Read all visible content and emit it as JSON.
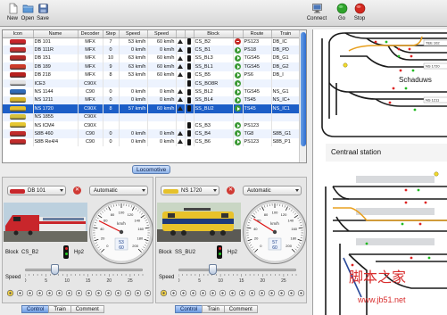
{
  "toolbar": {
    "new_label": "New",
    "open_label": "Open",
    "save_label": "Save",
    "connect_label": "Connect",
    "go_label": "Go",
    "stop_label": "Stop"
  },
  "table": {
    "headers": [
      "Icon",
      "Name",
      "Decoder",
      "Step",
      "Speed",
      "Speed",
      "",
      "",
      "Block",
      "",
      "Route",
      "Train"
    ],
    "rows": [
      {
        "name": "DB 101",
        "decoder": "MFX",
        "step": "7",
        "speed1": "53 km/h",
        "speed2": "60 km/h",
        "block": "CS_B2",
        "signal": "stop",
        "route": "PS123",
        "train": "DB_IC",
        "color": "#c8262b"
      },
      {
        "name": "DB 111R",
        "decoder": "MFX",
        "step": "0",
        "speed1": "0 km/h",
        "speed2": "0 km/h",
        "block": "CS_B1",
        "signal": "go",
        "route": "PS18",
        "train": "DB_PD",
        "color": "#c43030"
      },
      {
        "name": "DB 151",
        "decoder": "MFX",
        "step": "10",
        "speed1": "63 km/h",
        "speed2": "60 km/h",
        "block": "SS_BL3",
        "signal": "go",
        "route": "TGS45",
        "train": "DB_G1",
        "color": "#b52a27"
      },
      {
        "name": "DB 189",
        "decoder": "MFX",
        "step": "9",
        "speed1": "63 km/h",
        "speed2": "60 km/h",
        "block": "SS_BL1",
        "signal": "go",
        "route": "TGS45",
        "train": "DB_G2",
        "color": "#cc3b2a"
      },
      {
        "name": "DB 218",
        "decoder": "MFX",
        "step": "8",
        "speed1": "53 km/h",
        "speed2": "60 km/h",
        "block": "CS_B5",
        "signal": "go",
        "route": "PS6",
        "train": "DB_I",
        "color": "#b8211f"
      },
      {
        "name": "ICE3",
        "decoder": "C90X",
        "step": "",
        "speed1": "",
        "speed2": "",
        "block": "CS_BO8R",
        "signal": "go",
        "route": "",
        "train": "",
        "color": "#e4e4e4"
      },
      {
        "name": "NS 1144",
        "decoder": "C90",
        "step": "0",
        "speed1": "0 km/h",
        "speed2": "0 km/h",
        "block": "SS_BL2",
        "signal": "go",
        "route": "TGS45",
        "train": "NS_G1",
        "color": "#2f6bb8"
      },
      {
        "name": "NS 1211",
        "decoder": "MFX",
        "step": "0",
        "speed1": "0 km/h",
        "speed2": "0 km/h",
        "block": "SS_BL4",
        "signal": "go",
        "route": "TS45",
        "train": "NS_IC+",
        "color": "#d8b628"
      },
      {
        "name": "NS 1720",
        "decoder": "C90X",
        "step": "8",
        "speed1": "57 km/h",
        "speed2": "60 km/h",
        "block": "SS_BU2",
        "signal": "go",
        "route": "TS45",
        "train": "NS_IC1",
        "color": "#e5c12c"
      },
      {
        "name": "NS 1855",
        "decoder": "C90X",
        "step": "",
        "speed1": "",
        "speed2": "",
        "block": "",
        "signal": "",
        "route": "",
        "train": "",
        "color": "#d6c13a"
      },
      {
        "name": "NS ICM4",
        "decoder": "C90X",
        "step": "",
        "speed1": "",
        "speed2": "",
        "block": "CS_B3",
        "signal": "go",
        "route": "PS123",
        "train": "",
        "color": "#e6c731"
      },
      {
        "name": "S8B 460",
        "decoder": "C90",
        "step": "0",
        "speed1": "0 km/h",
        "speed2": "0 km/h",
        "block": "CS_B4",
        "signal": "go",
        "route": "TG8",
        "train": "S8B_G1",
        "color": "#c12b2b"
      },
      {
        "name": "S8B Re4/4",
        "decoder": "C90",
        "step": "0",
        "speed1": "0 km/h",
        "speed2": "0 km/h",
        "block": "CS_B6",
        "signal": "go",
        "route": "PS123",
        "train": "S8B_P1",
        "color": "#c12b2b"
      }
    ],
    "selected_index": 8
  },
  "splitter": {
    "tab_label": "Locomotive"
  },
  "control_left": {
    "loco": "DB 101",
    "mode": "Automatic",
    "block_label": "Block",
    "block": "CS_B2",
    "signal_label": "Hp2",
    "speed_label": "Speed",
    "speed": 53,
    "speed_max": 60,
    "slider": 7,
    "gauge_unit": "km/h",
    "gauge_value_a": "53",
    "gauge_value_b": "60",
    "gauge_ticks": [
      "0",
      "20",
      "40",
      "60",
      "80",
      "100",
      "120",
      "140",
      "160",
      "180",
      "200"
    ],
    "tick_labels": [
      "0",
      "5",
      "10",
      "15",
      "20",
      "25"
    ],
    "tabs": [
      "Control",
      "Train",
      "Comment"
    ],
    "active_tab": "Control",
    "loco_color": "#c8262b"
  },
  "control_right": {
    "loco": "NS 1720",
    "mode": "Automatic",
    "block_label": "Block",
    "block": "SS_BU2",
    "signal_label": "Hp2",
    "speed_label": "Speed",
    "speed": 57,
    "speed_max": 60,
    "slider": 8,
    "gauge_unit": "km/h",
    "gauge_value_a": "57",
    "gauge_value_b": "60",
    "gauge_ticks": [
      "0",
      "20",
      "40",
      "60",
      "80",
      "100",
      "120",
      "140",
      "160",
      "180",
      "200"
    ],
    "tick_labels": [
      "0",
      "5",
      "10",
      "15",
      "20",
      "25"
    ],
    "tabs": [
      "Control",
      "Train",
      "Comment"
    ],
    "active_tab": "Control",
    "loco_color": "#e5c12c"
  },
  "layout": {
    "station1": "Schaduws",
    "station2": "Centraal station",
    "labels": [
      "TEE 102",
      "NS 1720",
      "NS 1211"
    ],
    "watermark_cn": "脚本之家",
    "watermark_url": "www.jb51.net"
  },
  "colors": {
    "selection": "#1c5ec7",
    "track": "#1a1a1a",
    "track_route": "#e8a020",
    "signal_red": "#d22",
    "signal_green": "#2b2"
  }
}
